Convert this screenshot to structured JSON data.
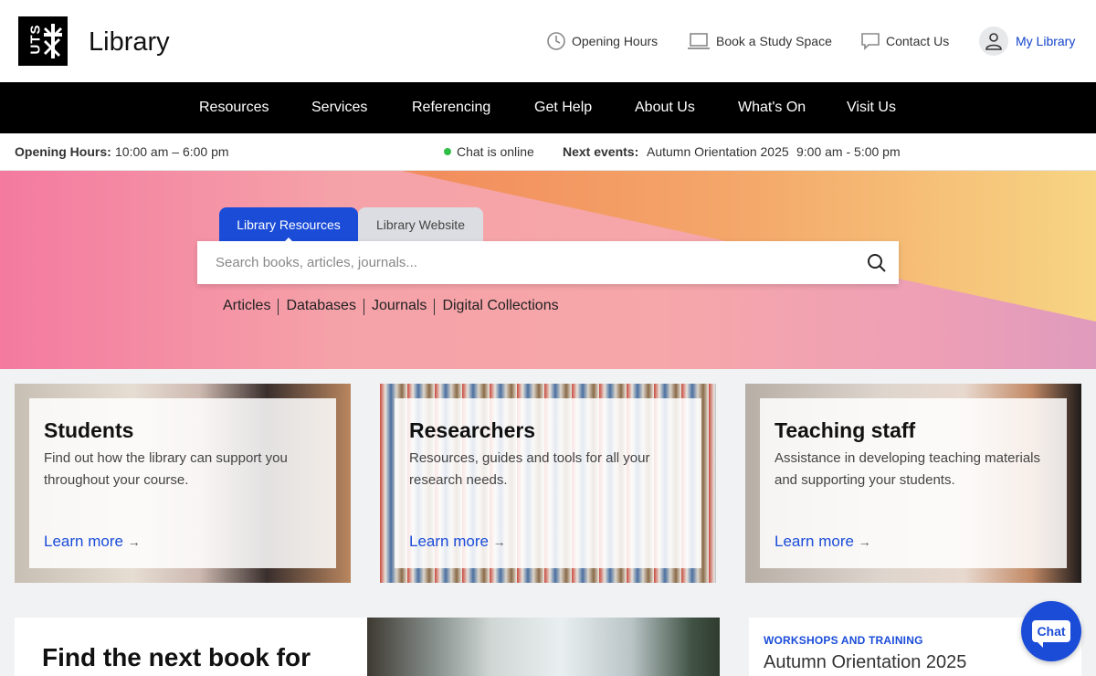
{
  "header": {
    "logo_text": "UTS",
    "brand": "Library",
    "utilities": [
      {
        "label": "Opening Hours",
        "icon": "clock-icon"
      },
      {
        "label": "Book a Study Space",
        "icon": "laptop-icon"
      },
      {
        "label": "Contact Us",
        "icon": "chat-bubble-icon"
      }
    ],
    "my_library": "My Library"
  },
  "nav": [
    "Resources",
    "Services",
    "Referencing",
    "Get Help",
    "About Us",
    "What's On",
    "Visit Us"
  ],
  "infobar": {
    "hours_label": "Opening Hours:",
    "hours_value": "10:00 am – 6:00 pm",
    "chat_status": "Chat is online",
    "events_label": "Next events:",
    "events_value": "Autumn Orientation 2025",
    "events_time": "9:00 am - 5:00 pm"
  },
  "search": {
    "tabs": [
      "Library Resources",
      "Library Website"
    ],
    "active_tab": "Library Resources",
    "placeholder": "Search books, articles, journals...",
    "quick_links": [
      "Articles",
      "Databases",
      "Journals",
      "Digital Collections"
    ]
  },
  "cards": [
    {
      "title": "Students",
      "text": "Find out how the library can support you throughout your course.",
      "link": "Learn more"
    },
    {
      "title": "Researchers",
      "text": "Resources, guides and tools for all your research needs.",
      "link": "Learn more"
    },
    {
      "title": "Teaching staff",
      "text": "Assistance in developing teaching materials and supporting your students.",
      "link": "Learn more"
    }
  ],
  "feature": {
    "title": "Find the next book for"
  },
  "event": {
    "kicker": "WORKSHOPS AND TRAINING",
    "title": "Autumn Orientation 2025"
  },
  "chat_button": "Chat",
  "colors": {
    "accent": "#1a4cd8",
    "nav": "#000000",
    "online": "#2fbf46"
  }
}
